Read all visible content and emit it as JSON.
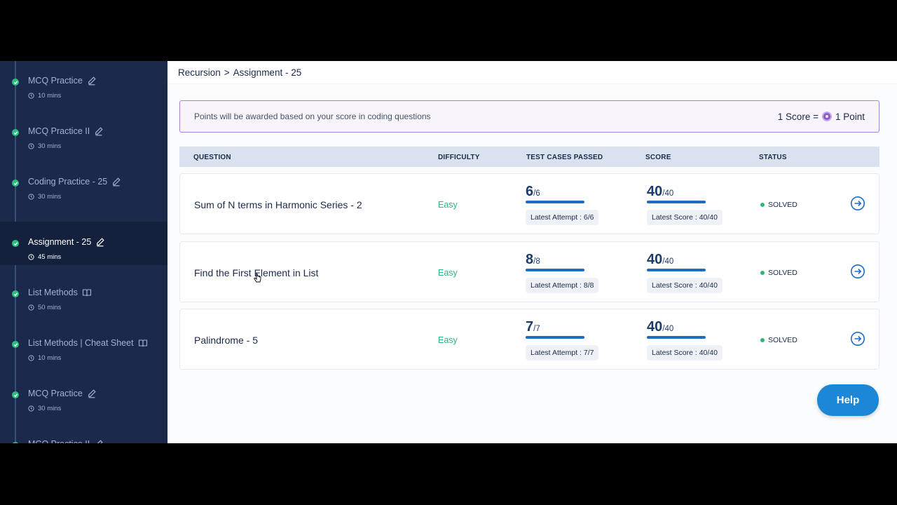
{
  "sidebar": {
    "items": [
      {
        "title": "",
        "duration": "",
        "icon": "edit-icon",
        "active": false,
        "partial": true
      },
      {
        "title": "MCQ Practice",
        "duration": "10 mins",
        "icon": "edit-icon",
        "active": false
      },
      {
        "title": "MCQ Practice II",
        "duration": "30 mins",
        "icon": "edit-icon",
        "active": false
      },
      {
        "title": "Coding Practice - 25",
        "duration": "30 mins",
        "icon": "edit-icon",
        "active": false
      },
      {
        "title": "Assignment - 25",
        "duration": "45 mins",
        "icon": "edit-icon",
        "active": true
      },
      {
        "title": "List Methods",
        "duration": "50 mins",
        "icon": "book-icon",
        "active": false
      },
      {
        "title": "List Methods | Cheat Sheet",
        "duration": "10 mins",
        "icon": "book-icon",
        "active": false
      },
      {
        "title": "MCQ Practice",
        "duration": "30 mins",
        "icon": "edit-icon",
        "active": false
      },
      {
        "title": "MCQ Practice II",
        "duration": "",
        "icon": "edit-icon",
        "active": false,
        "partial": true
      }
    ]
  },
  "breadcrumb": {
    "parent": "Recursion",
    "separator": ">",
    "current": "Assignment - 25"
  },
  "info": {
    "message": "Points will be awarded based on your score in coding questions",
    "rate_left": "1 Score =",
    "rate_right": "1 Point"
  },
  "table": {
    "headers": {
      "question": "QUESTION",
      "difficulty": "DIFFICULTY",
      "tests": "TEST CASES PASSED",
      "score": "SCORE",
      "status": "STATUS"
    },
    "rows": [
      {
        "title": "Sum of N terms in Harmonic Series - 2",
        "difficulty": "Easy",
        "passed": "6",
        "total": "/6",
        "attempt": "Latest Attempt : 6/6",
        "score": "40",
        "score_total": "/40",
        "latest_score": "Latest Score : 40/40",
        "status": "SOLVED"
      },
      {
        "title": "Find the First Element in List",
        "difficulty": "Easy",
        "passed": "8",
        "total": "/8",
        "attempt": "Latest Attempt : 8/8",
        "score": "40",
        "score_total": "/40",
        "latest_score": "Latest Score : 40/40",
        "status": "SOLVED"
      },
      {
        "title": "Palindrome - 5",
        "difficulty": "Easy",
        "passed": "7",
        "total": "/7",
        "attempt": "Latest Attempt : 7/7",
        "score": "40",
        "score_total": "/40",
        "latest_score": "Latest Score : 40/40",
        "status": "SOLVED"
      }
    ]
  },
  "help": {
    "label": "Help"
  },
  "colors": {
    "sidebar_bg": "#1b2a4a",
    "active_bg": "#13213d",
    "check": "#27c07d",
    "easy": "#2eb67d",
    "accent": "#1f6dbf",
    "help": "#1b87d6",
    "info_border": "#a981d6"
  }
}
